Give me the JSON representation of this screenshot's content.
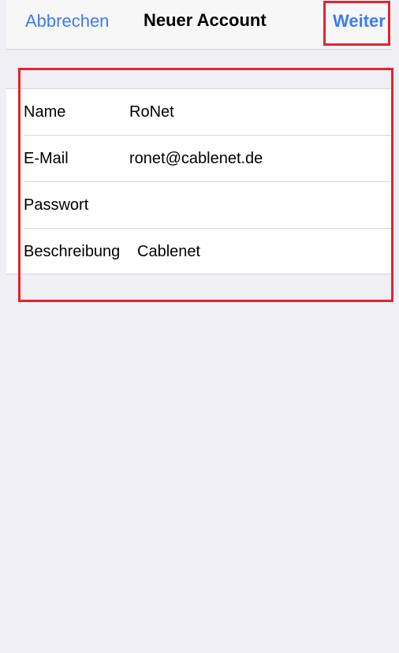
{
  "nav": {
    "cancel_label": "Abbrechen",
    "title": "Neuer Account",
    "next_label": "Weiter"
  },
  "form": {
    "rows": [
      {
        "label": "Name",
        "value": "RoNet"
      },
      {
        "label": "E-Mail",
        "value": "ronet@cablenet.de"
      },
      {
        "label": "Passwort",
        "value": ""
      },
      {
        "label": "Beschreibung",
        "value": "Cablenet"
      }
    ]
  },
  "colors": {
    "accent": "#3d7bf0",
    "highlight": "#e0252f",
    "background": "#efeff4"
  }
}
